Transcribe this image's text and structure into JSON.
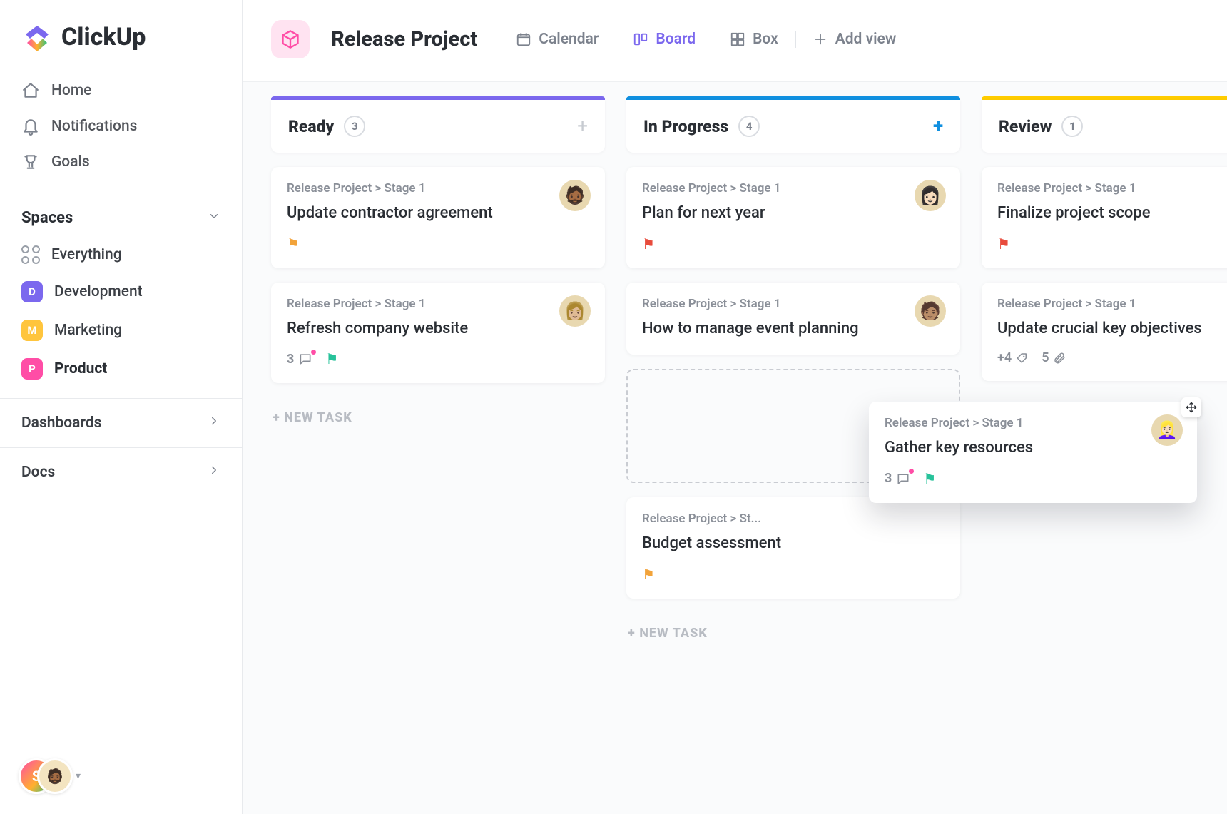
{
  "brand": "ClickUp",
  "sidebar": {
    "nav": {
      "home": "Home",
      "notifications": "Notifications",
      "goals": "Goals"
    },
    "spaces_header": "Spaces",
    "everything": "Everything",
    "spaces": [
      {
        "initial": "D",
        "label": "Development",
        "color": "purple"
      },
      {
        "initial": "M",
        "label": "Marketing",
        "color": "yellow"
      },
      {
        "initial": "P",
        "label": "Product",
        "color": "pink",
        "active": true
      }
    ],
    "dashboards": "Dashboards",
    "docs": "Docs",
    "user_initial": "S"
  },
  "header": {
    "title": "Release Project",
    "views": {
      "calendar": "Calendar",
      "board": "Board",
      "box": "Box",
      "add_view": "Add view"
    }
  },
  "board": {
    "new_task_label": "+ NEW TASK",
    "columns": [
      {
        "key": "ready",
        "title": "Ready",
        "count": "3",
        "accent": "purple",
        "cards": [
          {
            "crumb": "Release Project > Stage 1",
            "title": "Update contractor agreement",
            "flag": "orange",
            "avatar": "🧔🏾"
          },
          {
            "crumb": "Release Project > Stage 1",
            "title": "Refresh company website",
            "comments": "3",
            "flag": "green",
            "avatar": "👩🏼"
          }
        ]
      },
      {
        "key": "progress",
        "title": "In Progress",
        "count": "4",
        "accent": "blue",
        "add_highlight": true,
        "cards": [
          {
            "crumb": "Release Project > Stage 1",
            "title": "Plan for next year",
            "flag": "red",
            "avatar": "👩🏻"
          },
          {
            "crumb": "Release Project > Stage 1",
            "title": "How to manage event planning",
            "avatar": "🧑🏽"
          },
          {
            "dropzone": true
          },
          {
            "crumb": "Release Project > Stage 1",
            "title": "Budget assessment",
            "flag": "orange",
            "crumb_truncate": "Release Project > St..."
          }
        ]
      },
      {
        "key": "review",
        "title": "Review",
        "count": "1",
        "accent": "yellow",
        "cards": [
          {
            "crumb": "Release Project > Stage 1",
            "title": "Finalize project scope",
            "flag": "red"
          },
          {
            "crumb": "Release Project > Stage 1",
            "title": "Update crucial key objectives",
            "tags": "+4",
            "clips": "5"
          }
        ]
      }
    ],
    "dragging": {
      "crumb": "Release Project > Stage 1",
      "title": "Gather key resources",
      "comments": "3",
      "flag": "green",
      "avatar": "👱🏻‍♀️"
    }
  }
}
